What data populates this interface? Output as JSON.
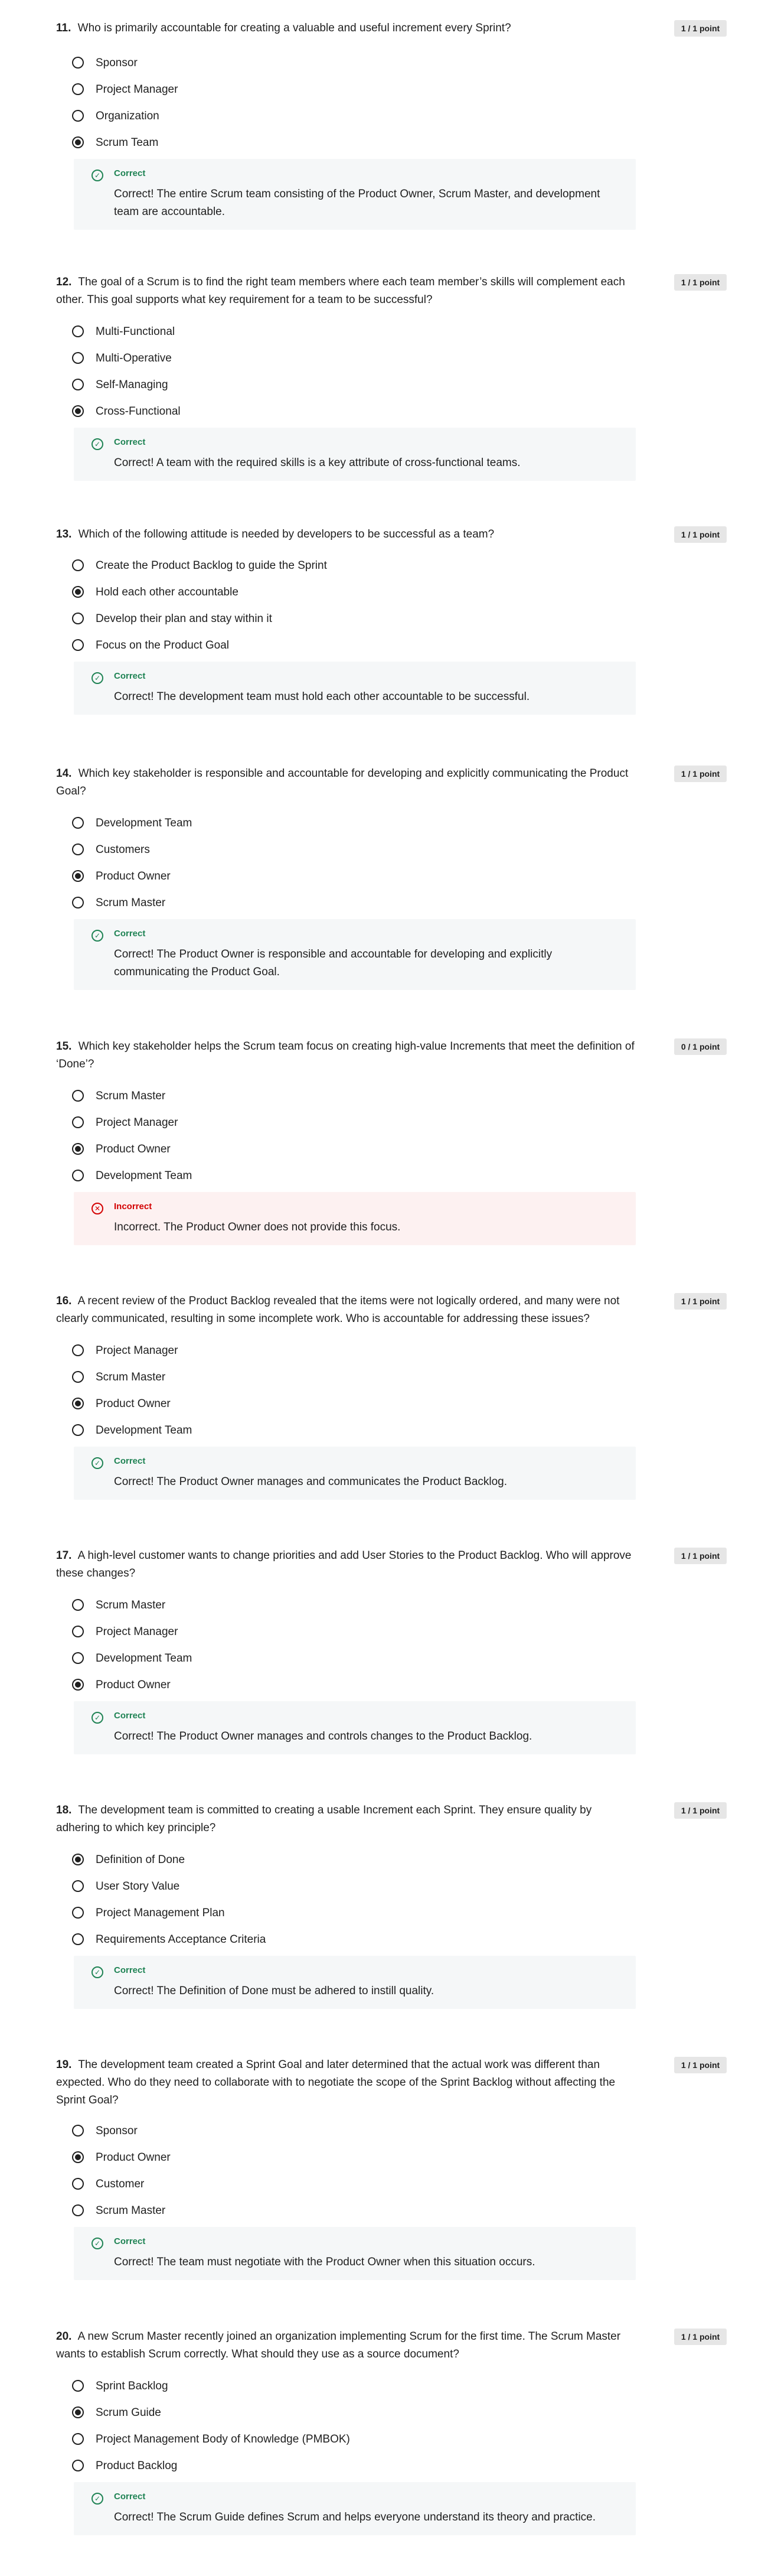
{
  "questions": [
    {
      "number": "11.",
      "text": "Who is primarily accountable for creating a valuable and useful increment every Sprint?",
      "points": "1 / 1 point",
      "options": [
        "Sponsor",
        "Project Manager",
        "Organization",
        "Scrum Team"
      ],
      "selected": 3,
      "feedback": {
        "status": "Correct",
        "text": "Correct! The entire Scrum team consisting of the Product Owner, Scrum Master, and development team are accountable."
      }
    },
    {
      "number": "12.",
      "text": "The goal of a Scrum is to find the right team members where each team member’s skills will complement each other. This goal supports what key requirement for a team to be successful?",
      "points": "1 / 1 point",
      "options": [
        "Multi-Functional",
        "Multi-Operative",
        "Self-Managing",
        "Cross-Functional"
      ],
      "selected": 3,
      "feedback": {
        "status": "Correct",
        "text": "Correct! A team with the required skills is a key attribute of cross-functional teams."
      }
    },
    {
      "number": "13.",
      "text": "Which of the following attitude is needed by developers to be successful as a team?",
      "points": "1 / 1 point",
      "options": [
        "Create the Product Backlog to guide the Sprint",
        "Hold each other accountable",
        "Develop their plan and stay within it",
        "Focus on the Product Goal"
      ],
      "selected": 1,
      "feedback": {
        "status": "Correct",
        "text": "Correct! The development team must hold each other accountable to be successful."
      }
    },
    {
      "number": "14.",
      "text": "Which key stakeholder is responsible and accountable for developing and explicitly communicating the Product Goal?",
      "points": "1 / 1 point",
      "options": [
        "Development Team",
        "Customers",
        "Product Owner",
        "Scrum Master"
      ],
      "selected": 2,
      "feedback": {
        "status": "Correct",
        "text": "Correct! The Product Owner is responsible and accountable for developing and explicitly communicating the Product Goal."
      }
    },
    {
      "number": "15.",
      "text": "Which key stakeholder helps the Scrum team focus on creating high-value Increments that meet the definition of ‘Done’?",
      "points": "0 / 1 point",
      "options": [
        "Scrum Master",
        "Project Manager",
        "Product Owner",
        "Development Team"
      ],
      "selected": 2,
      "feedback": {
        "status": "Incorrect",
        "text": "Incorrect. The Product Owner does not provide this focus."
      }
    },
    {
      "number": "16.",
      "text": "A recent review of the Product Backlog revealed that the items were not logically ordered, and many were not clearly communicated, resulting in some incomplete work. Who is accountable for addressing these issues?",
      "points": "1 / 1 point",
      "options": [
        "Project Manager",
        "Scrum Master",
        "Product Owner",
        "Development Team"
      ],
      "selected": 2,
      "feedback": {
        "status": "Correct",
        "text": "Correct! The Product Owner manages and communicates the Product Backlog."
      }
    },
    {
      "number": "17.",
      "text": "A high-level customer wants to change priorities and add User Stories to the Product Backlog. Who will approve these changes?",
      "points": "1 / 1 point",
      "options": [
        "Scrum Master",
        "Project Manager",
        "Development Team",
        "Product Owner"
      ],
      "selected": 3,
      "feedback": {
        "status": "Correct",
        "text": "Correct! The Product Owner manages and controls changes to the Product Backlog."
      }
    },
    {
      "number": "18.",
      "text": "The development team is committed to creating a usable Increment each Sprint. They ensure quality by adhering to which key principle?",
      "points": "1 / 1 point",
      "options": [
        "Definition of Done",
        "User Story Value",
        "Project Management Plan",
        "Requirements Acceptance Criteria"
      ],
      "selected": 0,
      "feedback": {
        "status": "Correct",
        "text": "Correct! The Definition of Done must be adhered to instill quality."
      }
    },
    {
      "number": "19.",
      "text": "The development team created a Sprint Goal and later determined that the actual work was different than expected. Who do they need to collaborate with to negotiate the scope of the Sprint Backlog without affecting the Sprint Goal?",
      "points": "1 / 1 point",
      "options": [
        "Sponsor",
        "Product Owner",
        "Customer",
        "Scrum Master"
      ],
      "selected": 1,
      "feedback": {
        "status": "Correct",
        "text": "Correct! The team must negotiate with the Product Owner when this situation occurs."
      }
    },
    {
      "number": "20.",
      "text": "A new Scrum Master recently joined an organization implementing Scrum for the first time. The Scrum Master wants to establish Scrum correctly. What should they use as a source document?",
      "points": "1 / 1 point",
      "options": [
        "Sprint Backlog",
        "Scrum Guide",
        "Project Management Body of Knowledge (PMBOK)",
        "Product Backlog"
      ],
      "selected": 1,
      "feedback": {
        "status": "Correct",
        "text": "Correct! The Scrum Guide defines Scrum and helps everyone understand its theory and practice."
      }
    }
  ]
}
